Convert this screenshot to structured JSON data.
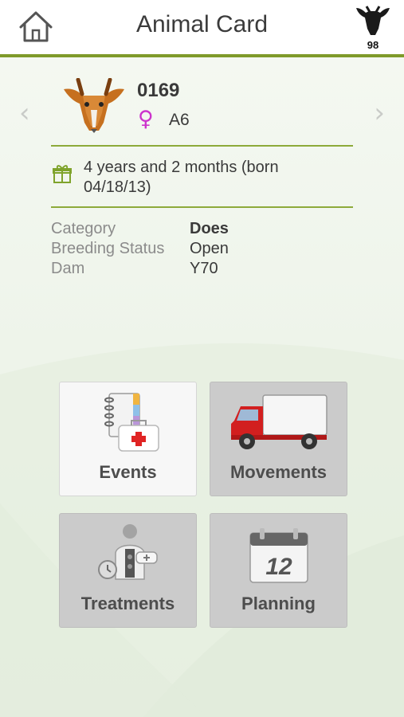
{
  "header": {
    "title": "Animal Card",
    "herd_count": "98"
  },
  "animal": {
    "id": "0169",
    "sex_symbol": "♀",
    "tag": "A6",
    "age": "4 years and 2 months (born 04/18/13)"
  },
  "details": [
    {
      "label": "Category",
      "value": "Does"
    },
    {
      "label": "Breeding Status",
      "value": "Open"
    },
    {
      "label": "Dam",
      "value": "Y70"
    }
  ],
  "nav": {
    "prev": "‹",
    "next": "›"
  },
  "tiles": {
    "events": "Events",
    "movements": "Movements",
    "treatments": "Treatments",
    "planning": "Planning",
    "calendar_day": "12"
  },
  "colors": {
    "accent_green": "#7f9a2a",
    "sex_magenta": "#cc33cc",
    "truck_red": "#d21f1f"
  },
  "icons": [
    "home-icon",
    "goat-head-icon",
    "female-icon",
    "gift-icon",
    "notebook-medkit-icon",
    "truck-icon",
    "veterinarian-icon",
    "calendar-icon"
  ]
}
